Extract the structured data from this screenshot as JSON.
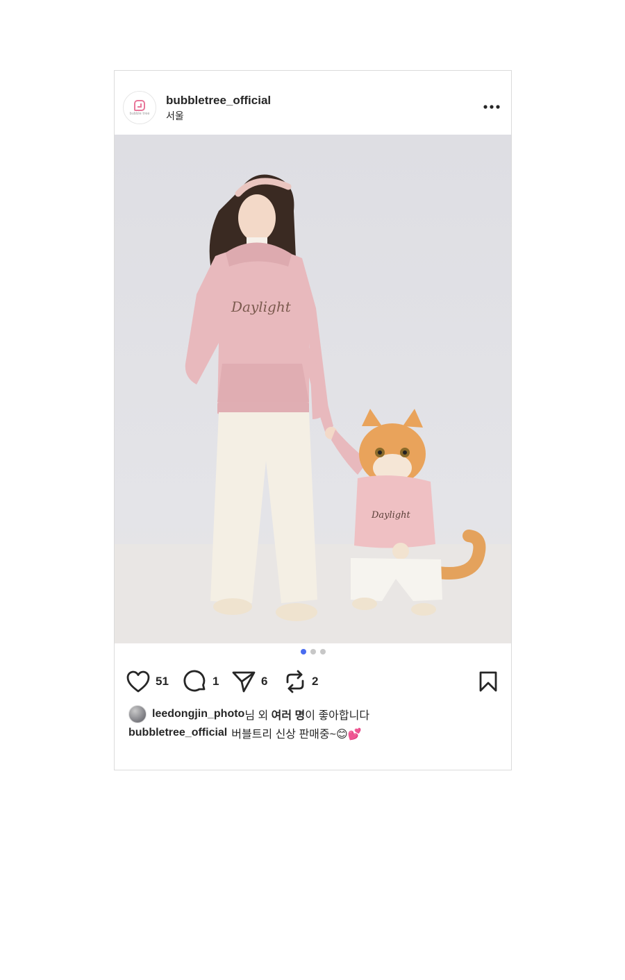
{
  "post": {
    "username": "bubbletree_official",
    "location": "서울",
    "avatar_text": "bubble tree",
    "more_icon": "more-horizontal-icon"
  },
  "photo": {
    "print_text_girl": "Daylight",
    "print_text_cat": "Daylight"
  },
  "carousel": {
    "total": 3,
    "active_index": 0
  },
  "actions": {
    "likes_count": "51",
    "comments_count": "1",
    "shares_count": "6",
    "reposts_count": "2"
  },
  "liked_by": {
    "user": "leedongjin_photo",
    "suffix_1": "님 외 ",
    "others": "여러 명",
    "suffix_2": "이 좋아합니다"
  },
  "caption": {
    "username": "bubbletree_official",
    "text": "버블트리 신상 판매중~😊💕"
  },
  "colors": {
    "accent_dot": "#4a6cf0",
    "brand_pink": "#e8779a"
  }
}
